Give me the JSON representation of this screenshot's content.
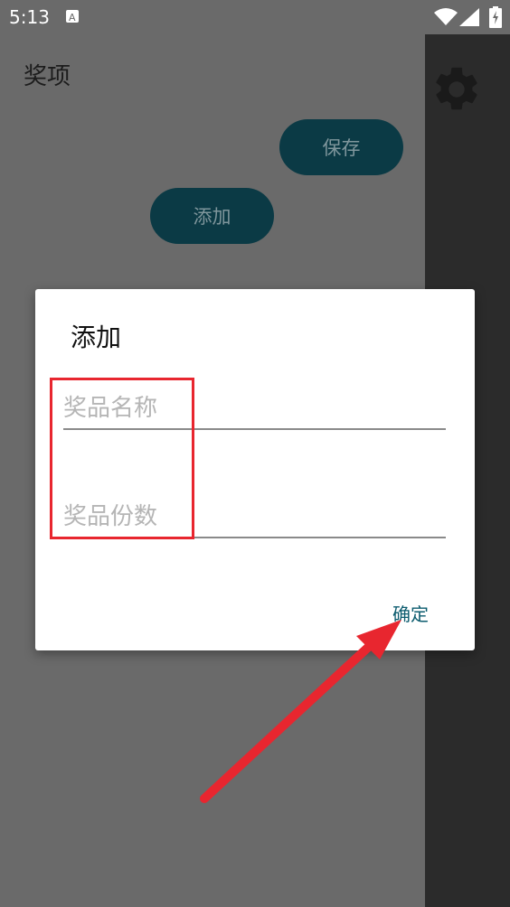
{
  "status_bar": {
    "time": "5:13",
    "icons": [
      "notification-a-icon",
      "wifi-icon",
      "signal-icon",
      "battery-icon"
    ]
  },
  "app_bar": {
    "title": "奖项",
    "settings_icon": "gear-icon"
  },
  "main": {
    "save_label": "保存",
    "add_label": "添加"
  },
  "dialog": {
    "title": "添加",
    "name_placeholder": "奖品名称",
    "count_placeholder": "奖品份数",
    "confirm_label": "确定"
  },
  "colors": {
    "scrim": "#6a6a6a",
    "side_panel": "#2b2b2b",
    "button_bg": "#0b3a45",
    "accent": "#0b5b6e",
    "annotation_red": "#e8262f"
  }
}
